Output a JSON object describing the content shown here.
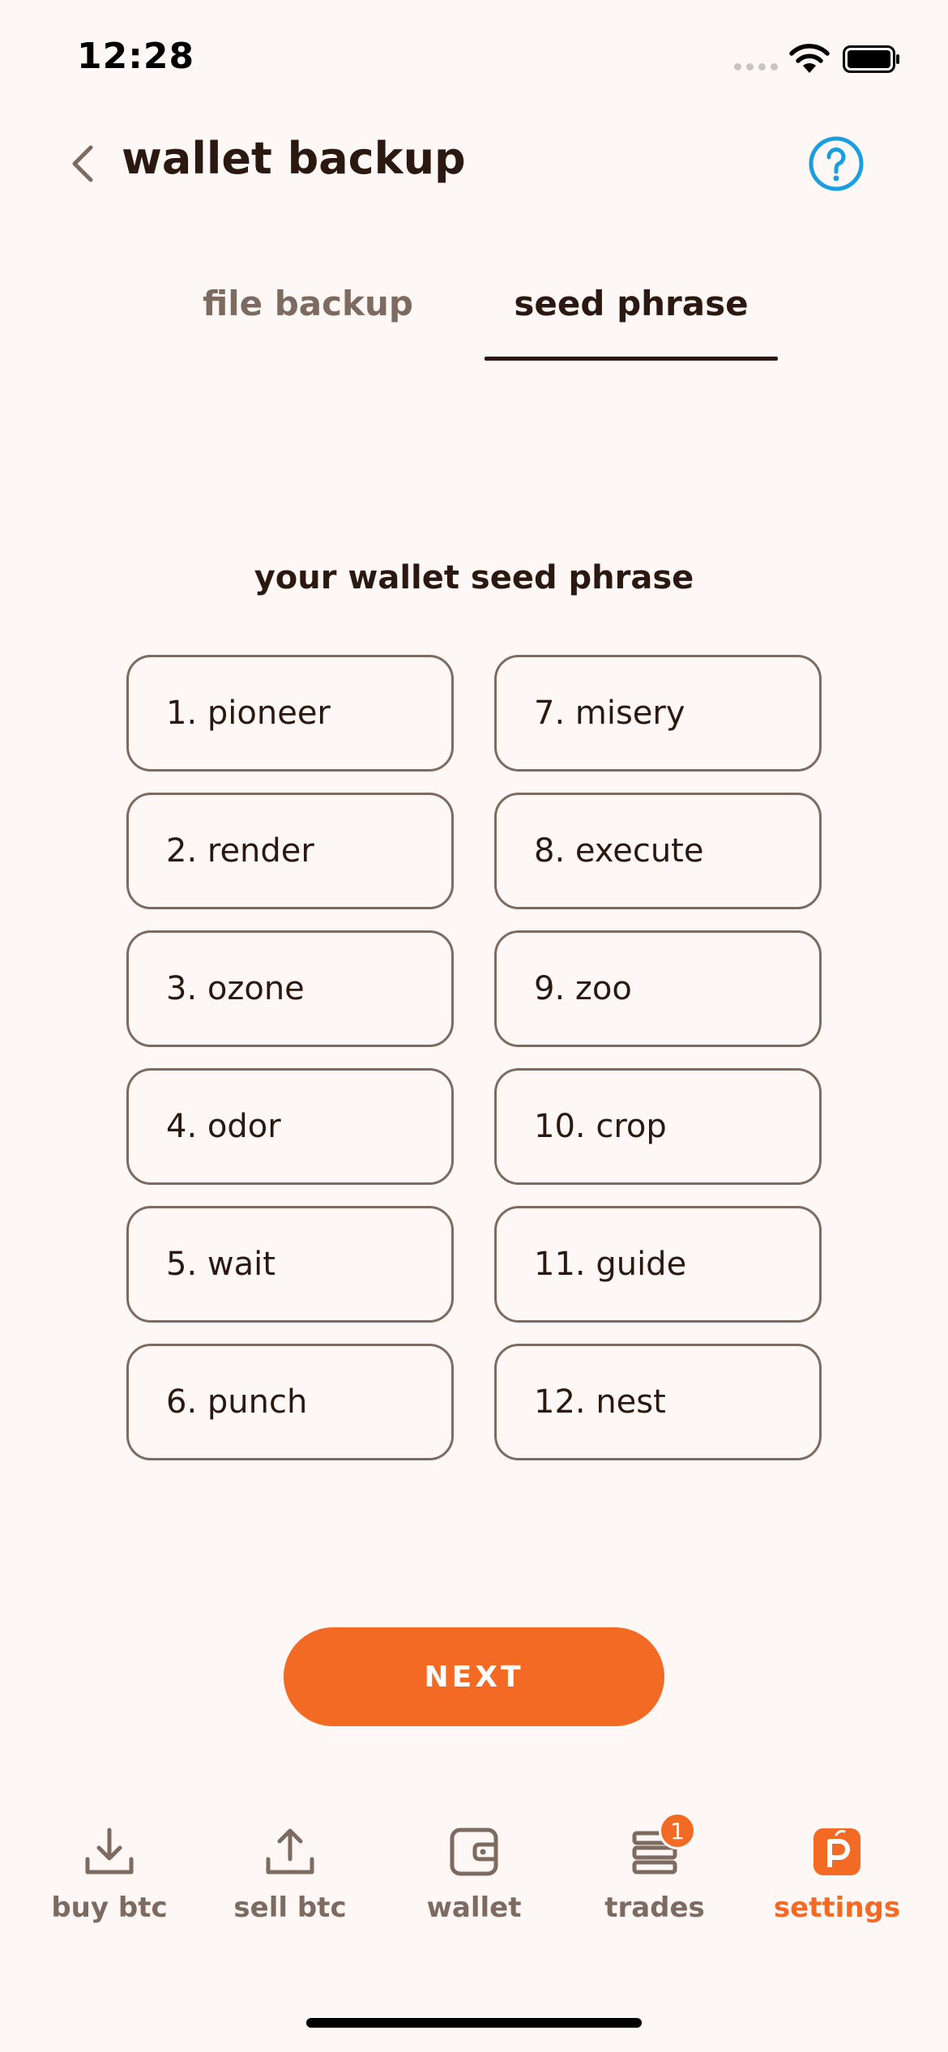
{
  "status_bar": {
    "time": "12:28"
  },
  "header": {
    "title": "wallet backup",
    "back_icon": "chevron-left-icon",
    "help_icon": "question-circle-icon"
  },
  "tabs": [
    {
      "label": "file backup",
      "active": false
    },
    {
      "label": "seed phrase",
      "active": true
    }
  ],
  "seed_section": {
    "heading": "your wallet seed phrase",
    "words": [
      "1. pioneer",
      "7. misery",
      "2. render",
      "8. execute",
      "3. ozone",
      "9. zoo",
      "4. odor",
      "10. crop",
      "5. wait",
      "11. guide",
      "6. punch",
      "12. nest"
    ]
  },
  "next_button": {
    "label": "NEXT"
  },
  "bottom_nav": {
    "items": [
      {
        "label": "buy btc",
        "icon": "download-icon"
      },
      {
        "label": "sell btc",
        "icon": "upload-icon"
      },
      {
        "label": "wallet",
        "icon": "wallet-icon"
      },
      {
        "label": "trades",
        "icon": "trades-stack-icon",
        "badge": "1"
      },
      {
        "label": "settings",
        "icon": "peach-logo-icon",
        "active": true
      }
    ]
  },
  "colors": {
    "background": "#fdf8f5",
    "primary_text": "#2b1911",
    "muted": "#7d6a61",
    "accent": "#f26a24",
    "help_icon": "#1b9ee0"
  }
}
